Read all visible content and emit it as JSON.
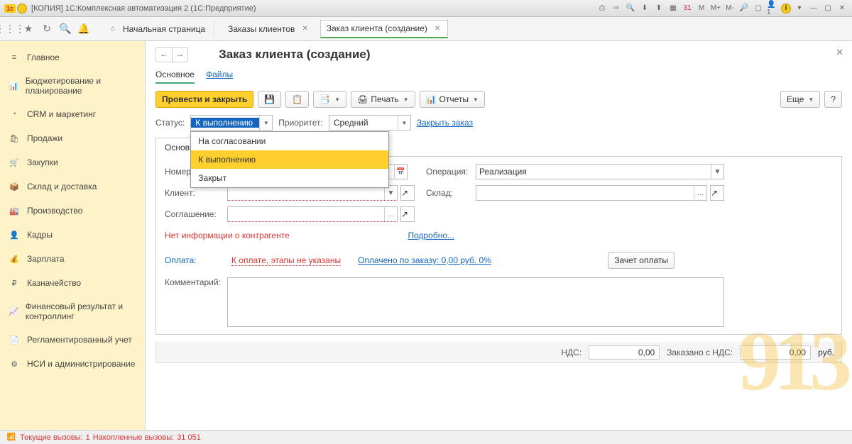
{
  "titlebar": {
    "title": "[КОПИЯ] 1С:Комплексная автоматизация 2 (1С:Предприятие)",
    "right_icons": [
      "print-icon",
      "send-icon",
      "search-icon",
      "down-icon",
      "out-icon",
      "calc-icon",
      "cal-icon",
      "m-icon",
      "m-plus-icon",
      "m-minus-icon",
      "zoom-icon",
      "max-icon",
      "user-icon",
      "info-icon",
      "dash-icon",
      "min-icon",
      "max2-icon",
      "close-icon"
    ]
  },
  "tabs": {
    "home": "Начальная страница",
    "orders": "Заказы клиентов",
    "new_order": "Заказ клиента (создание)"
  },
  "sidebar": {
    "items": [
      {
        "icon": "menu",
        "label": "Главное"
      },
      {
        "icon": "chart",
        "label": "Бюджетирование и планирование"
      },
      {
        "icon": "pie",
        "label": "CRM и маркетинг"
      },
      {
        "icon": "bag",
        "label": "Продажи"
      },
      {
        "icon": "cart",
        "label": "Закупки"
      },
      {
        "icon": "box",
        "label": "Склад и доставка"
      },
      {
        "icon": "factory",
        "label": "Производство"
      },
      {
        "icon": "user",
        "label": "Кадры"
      },
      {
        "icon": "money",
        "label": "Зарплата"
      },
      {
        "icon": "coin",
        "label": "Казначейство"
      },
      {
        "icon": "bars",
        "label": "Финансовый результат и контроллинг"
      },
      {
        "icon": "doc",
        "label": "Регламентированный учет"
      },
      {
        "icon": "gear",
        "label": "НСИ и администрирование"
      }
    ]
  },
  "page": {
    "title": "Заказ клиента (создание)",
    "subtabs": {
      "main": "Основное",
      "files": "Файлы"
    }
  },
  "toolbar": {
    "post_close": "Провести и закрыть",
    "print": "Печать",
    "reports": "Отчеты",
    "more": "Еще",
    "help": "?"
  },
  "status": {
    "label": "Статус:",
    "value": "К выполнению",
    "options": [
      "На согласовании",
      "К выполнению",
      "Закрыт"
    ],
    "priority_label": "Приоритет:",
    "priority_value": "Средний",
    "close_order": "Закрыть заказ"
  },
  "form": {
    "tab_main": "Основн",
    "number_label": "Номер:",
    "number_value": "",
    "operation_label": "Операция:",
    "operation_value": "Реализация",
    "client_label": "Клиент:",
    "client_value": "",
    "warehouse_label": "Склад:",
    "warehouse_value": "",
    "agreement_label": "Соглашение:",
    "agreement_value": "",
    "warn_text": "Нет информации о контрагенте",
    "warn_more": "Подробно...",
    "pay_label": "Оплата:",
    "pay_link1": "К оплате, этапы не указаны",
    "pay_link2": "Оплачено по заказу: 0,00 руб.   0%",
    "pay_credit": "Зачет оплаты",
    "comment_label": "Комментарий:"
  },
  "totals": {
    "nds_label": "НДС:",
    "nds_value": "0,00",
    "ordered_label": "Заказано с НДС:",
    "ordered_value": "0,00",
    "currency": "руб."
  },
  "statusbar": {
    "current_label": "Текущие вызовы:",
    "current_value": "1",
    "accum_label": "Накопленные вызовы:",
    "accum_value": "31 051"
  },
  "watermark": "913"
}
